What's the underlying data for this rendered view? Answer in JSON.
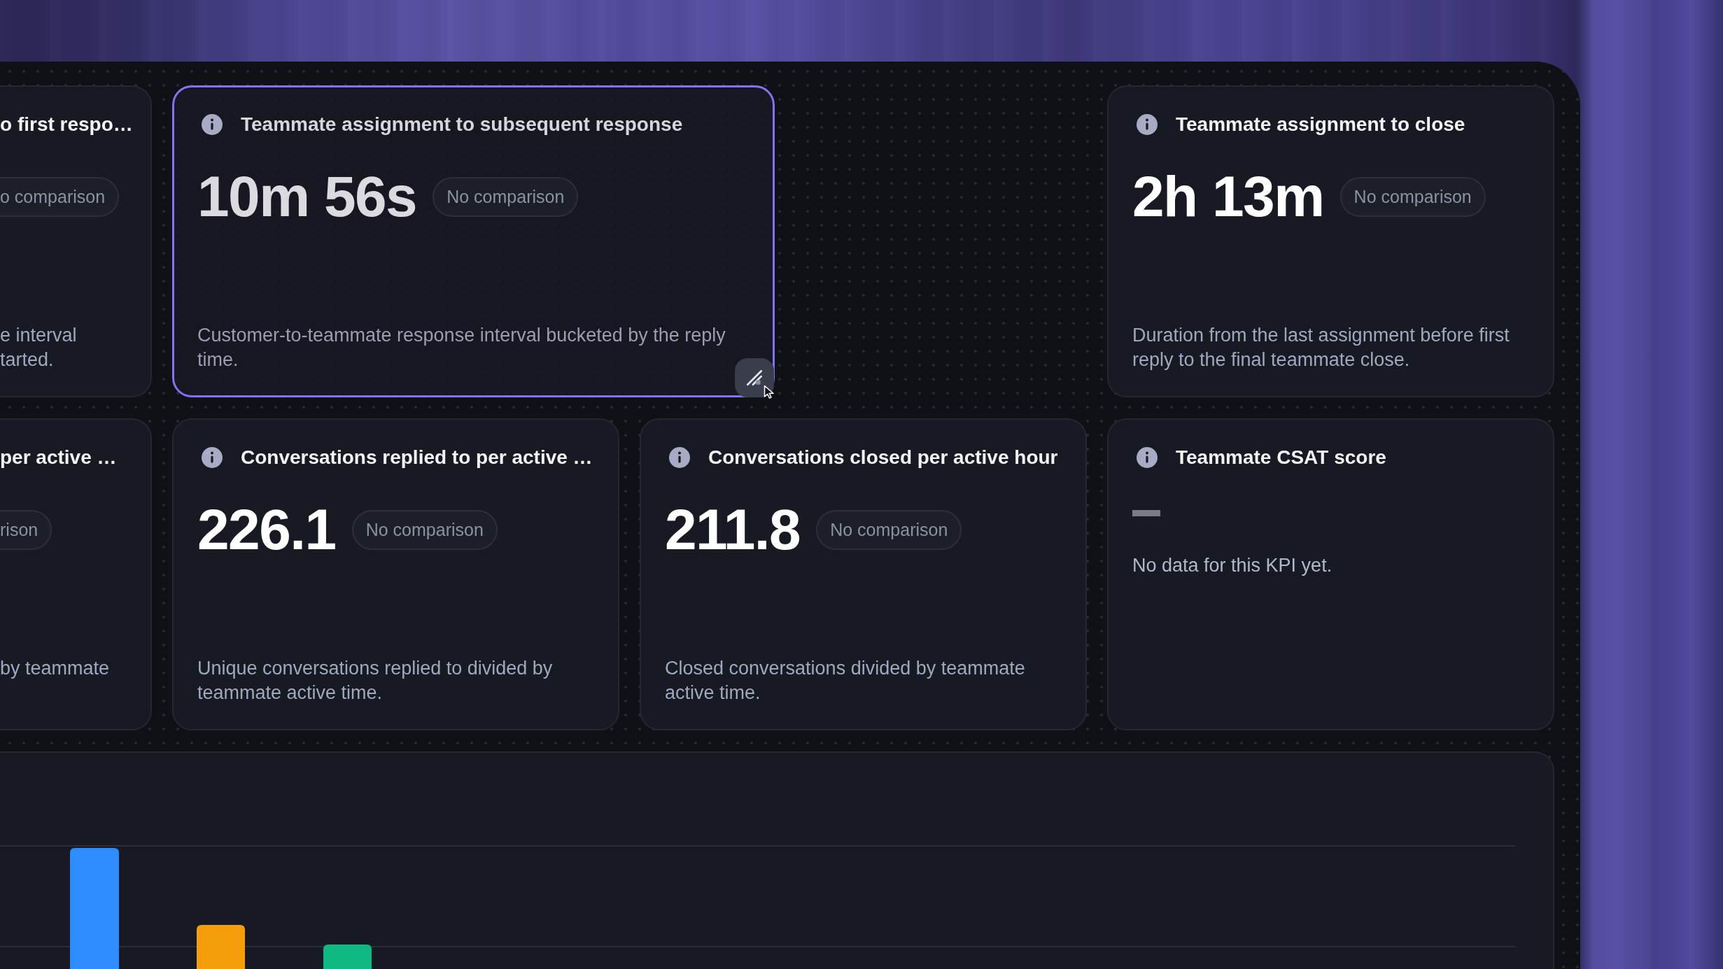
{
  "rows": [
    {
      "cards": [
        {
          "kind": "clipped",
          "selected": false,
          "title": "o first respo…",
          "comparison": "o comparison",
          "description": "e interval\ntarted."
        },
        {
          "kind": "metric",
          "selected": true,
          "title": "Teammate assignment to subsequent response",
          "value": "10m 56s",
          "comparison": "No comparison",
          "description": "Customer-to-teammate response interval bucketed by the reply time."
        },
        {
          "kind": "metric",
          "selected": false,
          "title": "Teammate assignment to close",
          "value": "2h 13m",
          "comparison": "No comparison",
          "description": "Duration from the last assignment before first reply to the final teammate close."
        }
      ]
    },
    {
      "cards": [
        {
          "kind": "clipped",
          "selected": false,
          "title": "per active …",
          "comparison": "rison",
          "description": "by teammate"
        },
        {
          "kind": "metric",
          "selected": false,
          "title": "Conversations replied to per active …",
          "value": "226.1",
          "comparison": "No comparison",
          "description": "Unique conversations replied to divided by teammate active time."
        },
        {
          "kind": "metric",
          "selected": false,
          "title": "Conversations closed per active hour",
          "value": "211.8",
          "comparison": "No comparison",
          "description": "Closed conversations divided by teammate active time."
        },
        {
          "kind": "empty",
          "selected": false,
          "title": "Teammate CSAT score",
          "message": "No data for this KPI yet."
        }
      ]
    }
  ]
}
